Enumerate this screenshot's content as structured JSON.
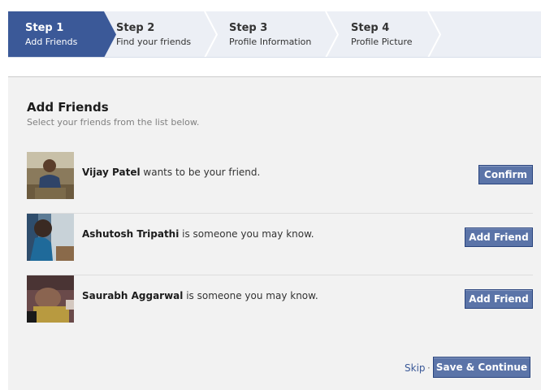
{
  "steps": [
    {
      "number": "Step 1",
      "label": "Add Friends"
    },
    {
      "number": "Step 2",
      "label": "Find your friends"
    },
    {
      "number": "Step 3",
      "label": "Profile Information"
    },
    {
      "number": "Step 4",
      "label": "Profile Picture"
    }
  ],
  "section": {
    "title": "Add Friends",
    "subtitle": "Select your friends from the list below."
  },
  "people": [
    {
      "name": "Vijay Patel",
      "message": " wants to be your friend.",
      "action": "Confirm"
    },
    {
      "name": "Ashutosh Tripathi",
      "message": " is someone you may know.",
      "action": "Add Friend"
    },
    {
      "name": "Saurabh Aggarwal",
      "message": " is someone you may know.",
      "action": "Add Friend"
    }
  ],
  "footer": {
    "skip_label": "Skip",
    "separator": "·",
    "save_label": "Save & Continue"
  },
  "colors": {
    "accent": "#3b5998",
    "button": "#5b74a8",
    "panel": "#f2f2f2",
    "steps_bg": "#eceff5"
  }
}
